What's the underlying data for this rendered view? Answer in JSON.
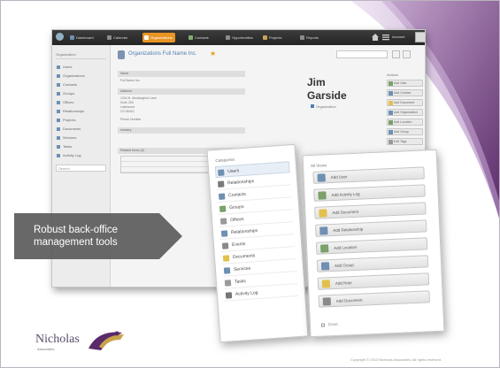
{
  "slide": {
    "callout_line1": "Robust back-office",
    "callout_line2": "management tools",
    "brand": "Nicholas",
    "brand_sub": "Associates",
    "copyright": "Copyright © 2013 Nicholas Associates. All rights reserved."
  },
  "app": {
    "nav_tabs": [
      {
        "label": "Dashboard",
        "color": "#6f8fb3",
        "active": false
      },
      {
        "label": "Calendar",
        "color": "#8c8c8c",
        "active": false
      },
      {
        "label": "Organizations",
        "color": "#ffffff",
        "active": true
      },
      {
        "label": "Contacts",
        "color": "#7fae6e",
        "active": false
      },
      {
        "label": "Opportunities",
        "color": "#8c8c8c",
        "active": false
      },
      {
        "label": "Projects",
        "color": "#c9a45a",
        "active": false
      },
      {
        "label": "Reports",
        "color": "#8c8c8c",
        "active": false
      }
    ],
    "user": "Account",
    "sidebar_heading": "Organization",
    "sidebar_items": [
      "Users",
      "Organizations",
      "Contacts",
      "Groups",
      "Offices",
      "Relationships",
      "Projects",
      "Documents",
      "Services",
      "Tasks",
      "Activity Log"
    ],
    "sidebar_search": "Search",
    "breadcrumb": "Organizations  Full Name Inc.",
    "panels": [
      "Name",
      "Address",
      "Industry",
      "Related Items (3)"
    ],
    "fields": [
      "Full Name Inc.",
      "1234 N. Mockingbird Lane",
      "Suite 200",
      "Lakewood",
      "CO 80401",
      "Phone Number"
    ],
    "profile_first": "Jim",
    "profile_last": "Garside",
    "profile_tag": "Organization",
    "actions_heading": "Actions",
    "actions": [
      {
        "label": "Add User",
        "color": "#7ba06a"
      },
      {
        "label": "Add Contact",
        "color": "#6f8fb3"
      },
      {
        "label": "Add Document",
        "color": "#e3c04d"
      },
      {
        "label": "Add Organization",
        "color": "#6f8fb3"
      },
      {
        "label": "Add Location",
        "color": "#7ba06a"
      },
      {
        "label": "Add Group",
        "color": "#6f8fb3"
      },
      {
        "label": "Edit Tags",
        "color": "#999999"
      }
    ]
  },
  "categories": {
    "title": "Categories",
    "items": [
      {
        "label": "Users",
        "color": "#6f8fb3",
        "selected": true
      },
      {
        "label": "Relationships",
        "color": "#7a7a7a",
        "selected": false
      },
      {
        "label": "Contacts",
        "color": "#6f8fb3",
        "selected": false
      },
      {
        "label": "Groups",
        "color": "#7ba06a",
        "selected": false
      },
      {
        "label": "Offices",
        "color": "#999999",
        "selected": false
      },
      {
        "label": "Relationships",
        "color": "#6f8fb3",
        "selected": false
      },
      {
        "label": "Events",
        "color": "#8a8a8a",
        "selected": false
      },
      {
        "label": "Documents",
        "color": "#e3c04d",
        "selected": false
      },
      {
        "label": "Services",
        "color": "#6f8fb3",
        "selected": false
      },
      {
        "label": "Tasks",
        "color": "#999999",
        "selected": false
      },
      {
        "label": "Activity Log",
        "color": "#777777",
        "selected": false
      }
    ]
  },
  "views": {
    "title": "All Views",
    "buttons": [
      {
        "label": "Add User",
        "color": "#6f8fb3"
      },
      {
        "label": "Add Activity Log",
        "color": "#7ba06a"
      },
      {
        "label": "Add Document",
        "color": "#e3c04d"
      },
      {
        "label": "Add Relationship",
        "color": "#6f8fb3"
      },
      {
        "label": "Add Location",
        "color": "#7ba06a"
      },
      {
        "label": "Add Group",
        "color": "#6f8fb3"
      },
      {
        "label": "Add Note",
        "color": "#e3c04d"
      },
      {
        "label": "Add Document",
        "color": "#8a8a8a"
      }
    ],
    "footer": "Done"
  },
  "colors": {
    "purple_dark": "#5a2a6a",
    "purple_light": "#b08ac0",
    "callout_bg": "#5b5b5b",
    "accent_orange": "#e99524"
  }
}
